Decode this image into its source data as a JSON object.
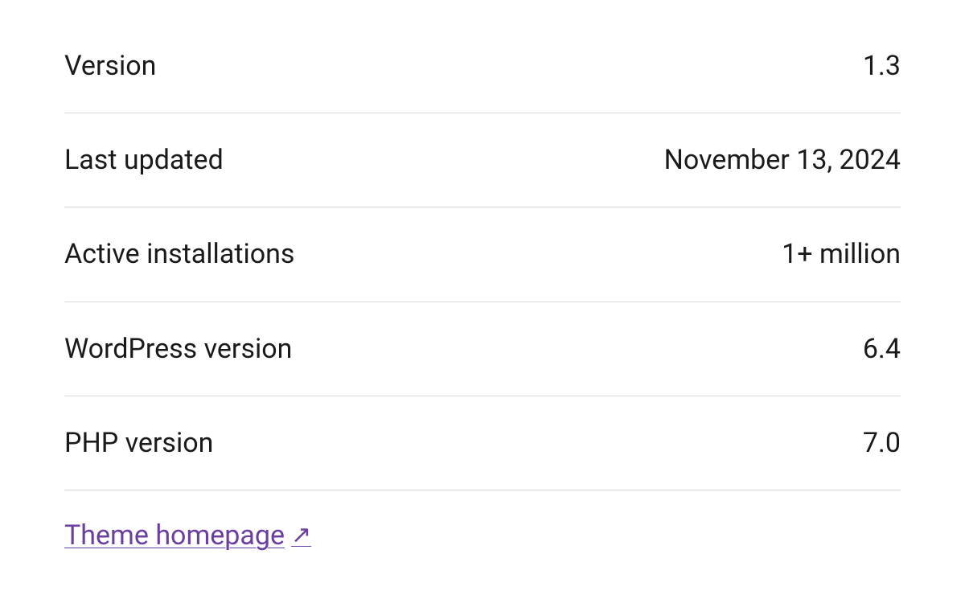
{
  "meta": {
    "rows": [
      {
        "label": "Version",
        "value": "1.3"
      },
      {
        "label": "Last updated",
        "value": "November 13, 2024"
      },
      {
        "label": "Active installations",
        "value": "1+ million"
      },
      {
        "label": "WordPress version",
        "value": "6.4"
      },
      {
        "label": "PHP version",
        "value": "7.0"
      }
    ],
    "link": {
      "label": "Theme homepage"
    }
  }
}
